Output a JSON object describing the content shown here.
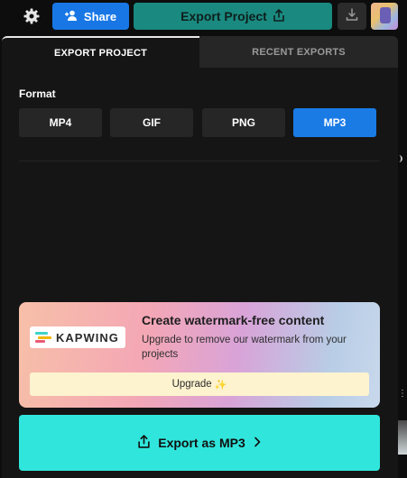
{
  "topbar": {
    "share_label": "Share",
    "export_label": "Export Project"
  },
  "tabs": [
    {
      "label": "EXPORT PROJECT",
      "active": true
    },
    {
      "label": "RECENT EXPORTS",
      "active": false
    }
  ],
  "format": {
    "label": "Format",
    "options": [
      "MP4",
      "GIF",
      "PNG",
      "MP3"
    ],
    "selected": "MP3"
  },
  "promo": {
    "logo_text": "KAPWING",
    "title": "Create watermark-free content",
    "description": "Upgrade to remove our watermark from your projects",
    "upgrade_label": "Upgrade"
  },
  "export_button": {
    "label": "Export as MP3"
  },
  "colors": {
    "share": "#1877e5",
    "export_top": "#1a8a80",
    "format_active": "#1a7be5",
    "export_main": "#30e6dc",
    "upgrade_bg": "#fdf3cf"
  },
  "icons": [
    "gear-icon",
    "add-person-icon",
    "share-upload-icon",
    "download-icon",
    "sparkle-icon",
    "chevron-right-icon"
  ]
}
